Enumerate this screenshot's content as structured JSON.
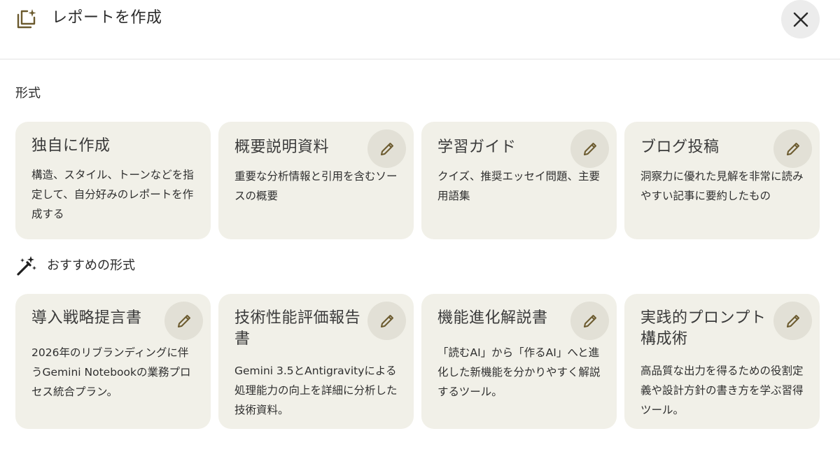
{
  "header": {
    "title": "レポートを作成",
    "icon": "report-sparkle-icon",
    "close_icon": "close-icon"
  },
  "sections": {
    "format_label": "形式",
    "recommended_label": "おすすめの形式"
  },
  "formats": [
    {
      "title": "独自に作成",
      "description": "構造、スタイル、トーンなどを指定して、自分好みのレポートを作成する",
      "editable": false
    },
    {
      "title": "概要説明資料",
      "description": "重要な分析情報と引用を含むソースの概要",
      "editable": true
    },
    {
      "title": "学習ガイド",
      "description": "クイズ、推奨エッセイ問題、主要用語集",
      "editable": true
    },
    {
      "title": "ブログ投稿",
      "description": "洞察力に優れた見解を非常に読みやすい記事に要約したもの",
      "editable": true
    }
  ],
  "recommended": [
    {
      "title": "導入戦略提言書",
      "description": "2026年のリブランディングに伴うGemini Notebookの業務プロセス統合プラン。",
      "editable": true
    },
    {
      "title": "技術性能評価報告書",
      "description": "Gemini 3.5とAntigravityによる処理能力の向上を詳細に分析した技術資料。",
      "editable": true
    },
    {
      "title": "機能進化解説書",
      "description": "「読むAI」から「作るAI」へと進化した新機能を分かりやすく解説するツール。",
      "editable": true
    },
    {
      "title": "実践的プロンプト構成術",
      "description": "高品質な出力を得るための役割定義や設計方針の書き方を学ぶ習得ツール。",
      "editable": true
    }
  ],
  "colors": {
    "card_background": "#f1f0e8",
    "edit_button_background": "#e2e0d6",
    "accent_icon": "#6b5a2e"
  }
}
